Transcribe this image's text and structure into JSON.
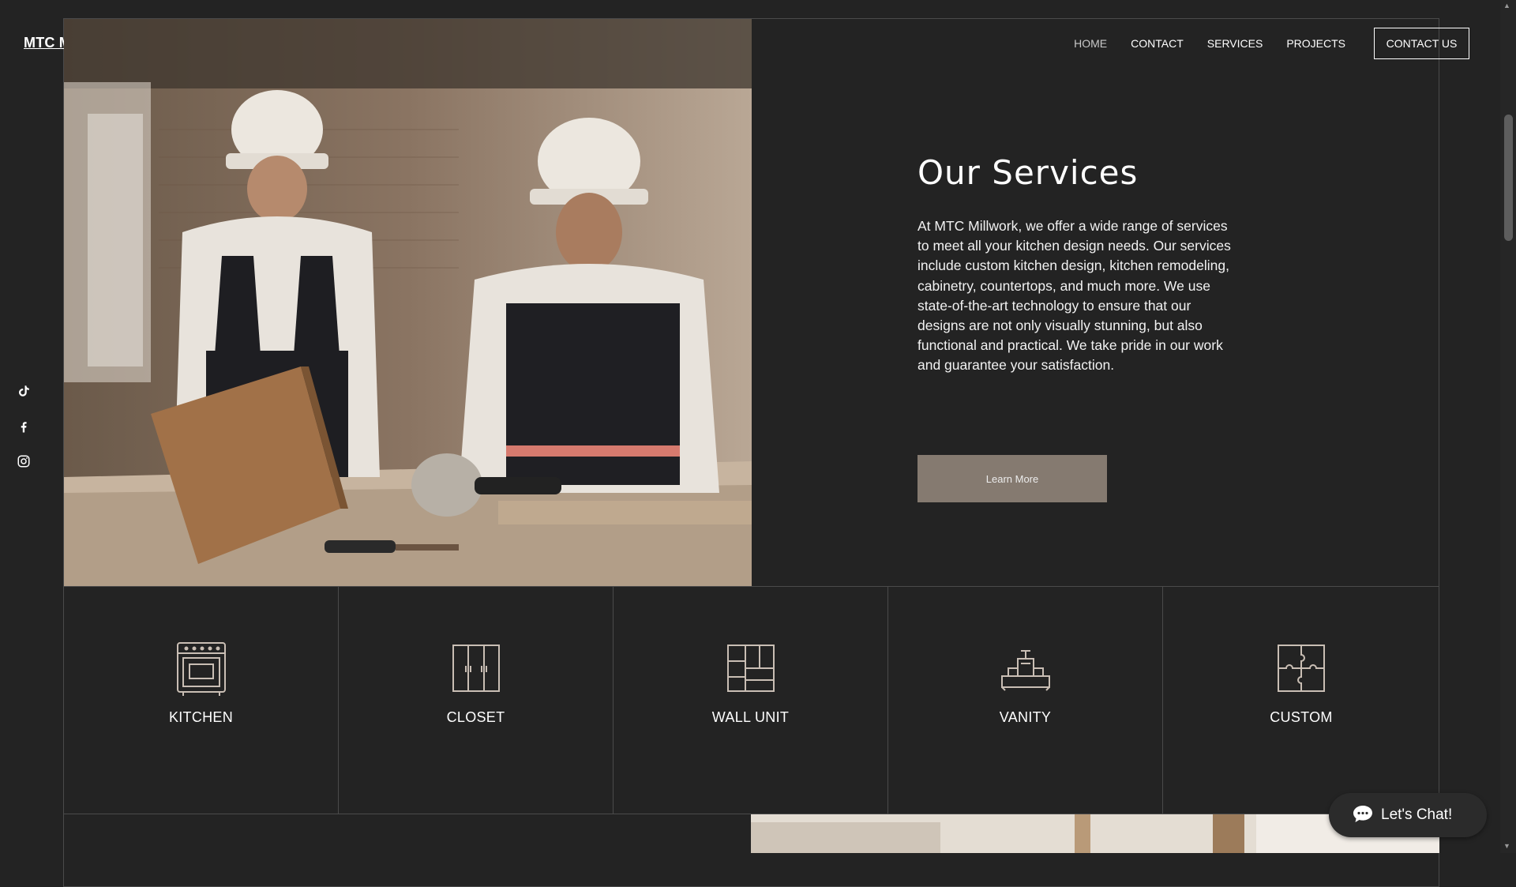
{
  "brand": {
    "logo": "MTC Millwork"
  },
  "nav": {
    "items": [
      "HOME",
      "CONTACT",
      "SERVICES",
      "PROJECTS"
    ],
    "cta": "CONTACT US"
  },
  "social": [
    "tiktok-icon",
    "facebook-icon",
    "instagram-icon"
  ],
  "services": {
    "title": "Our Services",
    "body": "At MTC Millwork, we offer a wide range of services to meet all your kitchen design needs. Our services include custom kitchen design, kitchen remodeling, cabinetry, countertops, and much more. We use state-of-the-art technology to ensure that our designs are not only visually stunning, but also functional and practical. We take pride in our work and guarantee your satisfaction.",
    "button": "Learn More"
  },
  "categories": [
    {
      "label": "KITCHEN",
      "icon": "oven-icon"
    },
    {
      "label": "CLOSET",
      "icon": "closet-icon"
    },
    {
      "label": "WALL UNIT",
      "icon": "wall-unit-icon"
    },
    {
      "label": "VANITY",
      "icon": "vanity-icon"
    },
    {
      "label": "CUSTOM",
      "icon": "puzzle-icon"
    }
  ],
  "chat": {
    "label": "Let's Chat!"
  },
  "colors": {
    "background": "#232323",
    "button": "#857a70",
    "line": "#4a4a4a",
    "icon": "#c9beb4"
  }
}
